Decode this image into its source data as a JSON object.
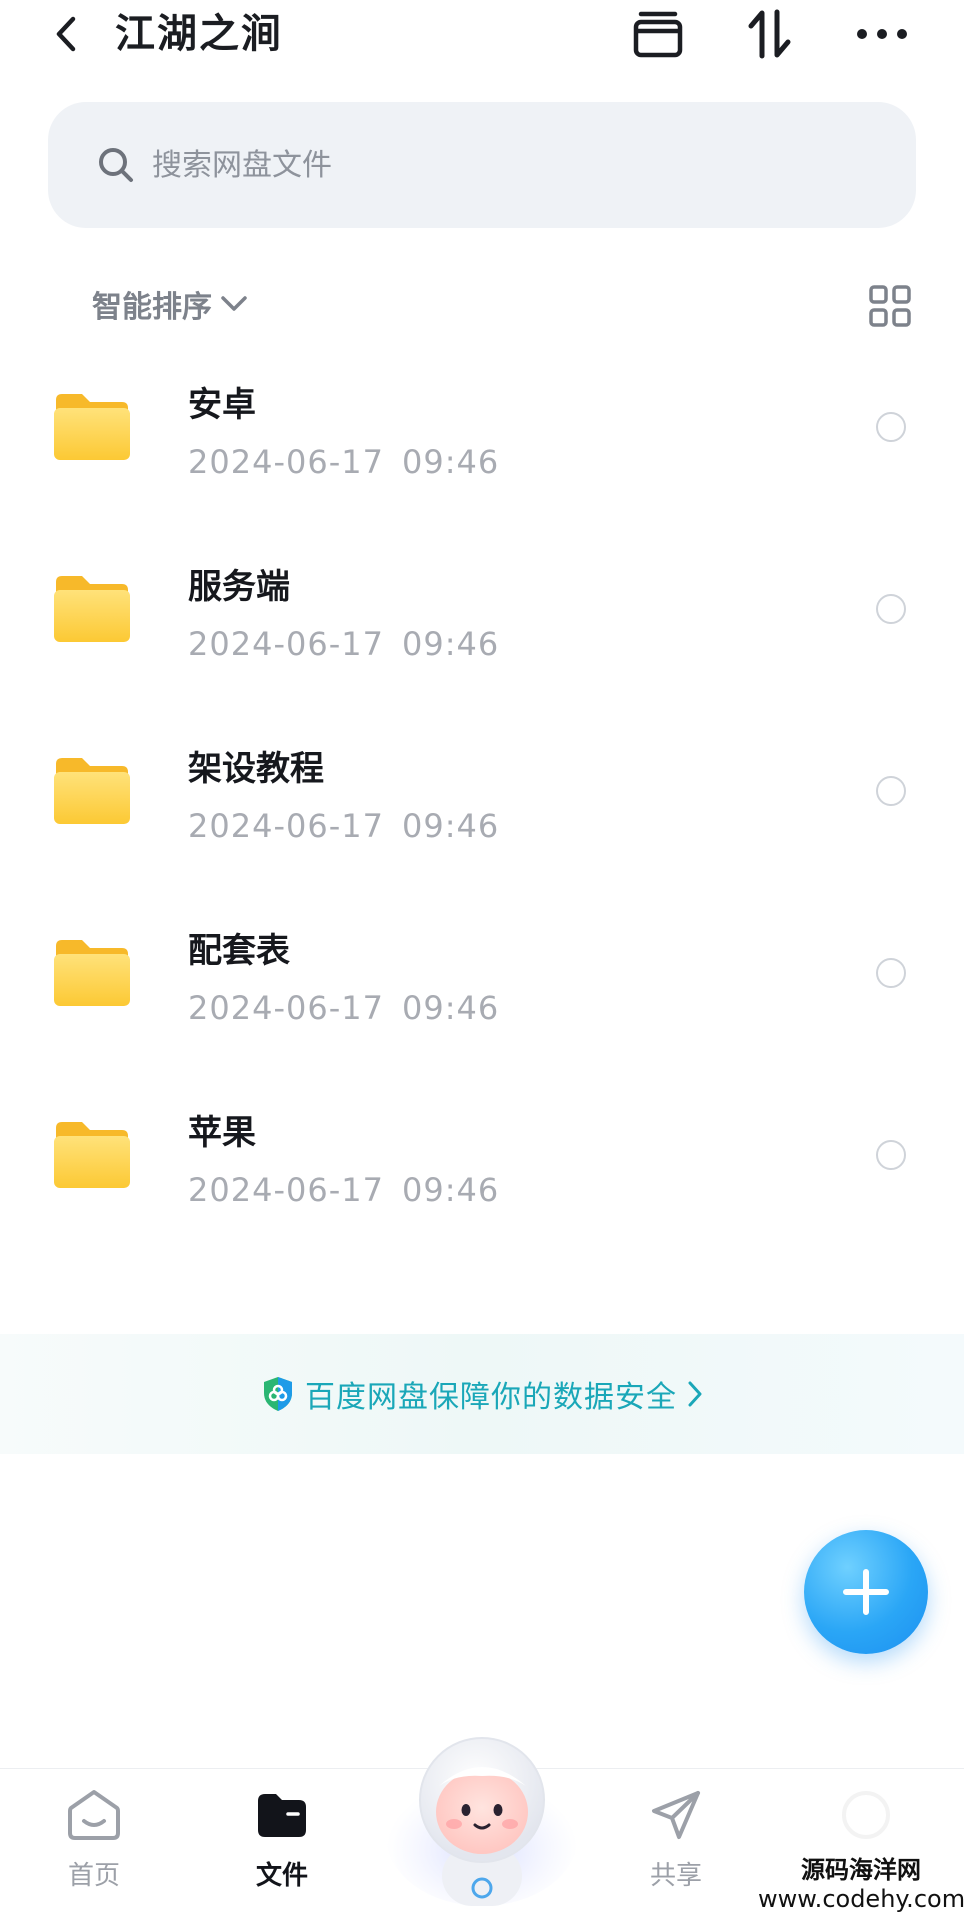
{
  "header": {
    "title": "江湖之涧",
    "back_icon": "chevron-left-icon",
    "actions": [
      "archive-icon",
      "sort-transfer-icon",
      "more-icon"
    ]
  },
  "search": {
    "placeholder": "搜索网盘文件"
  },
  "sort": {
    "label": "智能排序",
    "view_icon": "grid-view-icon"
  },
  "files": [
    {
      "name": "安卓",
      "date": "2024-06-17",
      "time": "09:46",
      "type": "folder"
    },
    {
      "name": "服务端",
      "date": "2024-06-17",
      "time": "09:46",
      "type": "folder"
    },
    {
      "name": "架设教程",
      "date": "2024-06-17",
      "time": "09:46",
      "type": "folder"
    },
    {
      "name": "配套表",
      "date": "2024-06-17",
      "time": "09:46",
      "type": "folder"
    },
    {
      "name": "苹果",
      "date": "2024-06-17",
      "time": "09:46",
      "type": "folder"
    }
  ],
  "security_banner": {
    "text": "百度网盘保障你的数据安全",
    "accent_color": "#1aa7b8"
  },
  "fab": {
    "icon": "plus-icon",
    "color": "#2aa6f6"
  },
  "tabs": [
    {
      "label": "首页",
      "icon": "home-face-icon",
      "active": false
    },
    {
      "label": "文件",
      "icon": "folder-icon",
      "active": true
    },
    {
      "label": "共享",
      "icon": "paper-plane-icon",
      "active": false
    },
    {
      "label": "",
      "icon": "profile-icon",
      "active": false
    }
  ],
  "watermark": {
    "line1": "源码海洋网",
    "line2": "www.codehy.com"
  }
}
